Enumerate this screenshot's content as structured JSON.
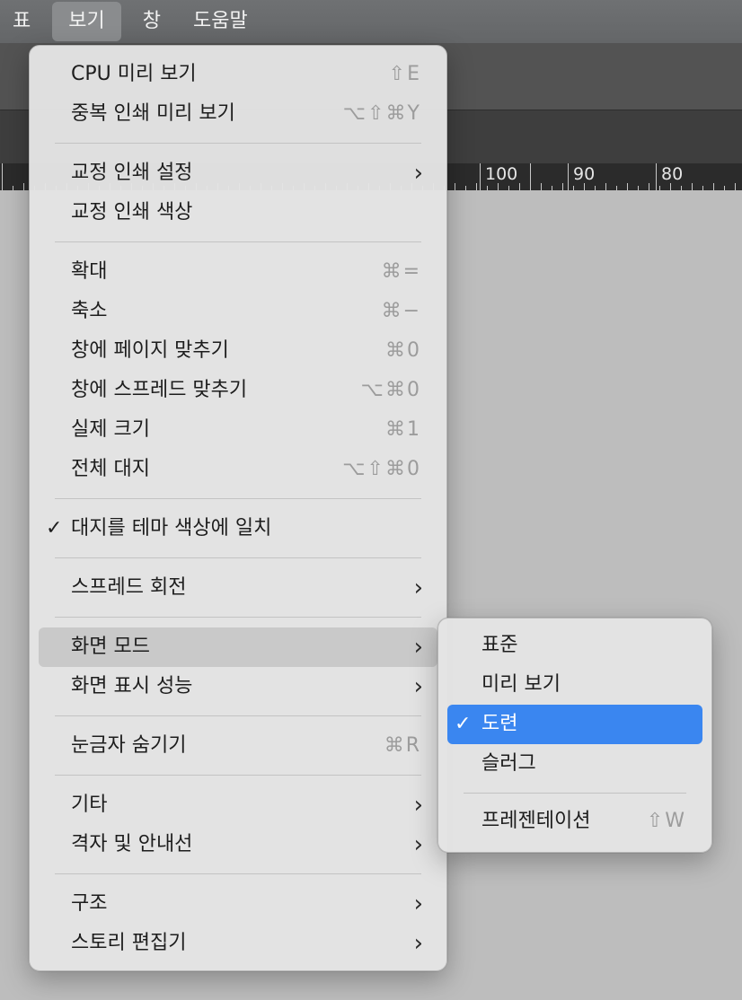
{
  "menubar": {
    "items": [
      {
        "label": "표"
      },
      {
        "label": "보기"
      },
      {
        "label": "창"
      },
      {
        "label": "도움말"
      }
    ]
  },
  "ruler": {
    "labels": [
      "100",
      "90",
      "80"
    ]
  },
  "view_menu": {
    "items": [
      {
        "label": "CPU 미리 보기",
        "shortcut": "⇧E"
      },
      {
        "label": "중복 인쇄 미리 보기",
        "shortcut": "⌥⇧⌘Y"
      },
      {
        "label": "교정 인쇄 설정",
        "submenu_arrow": "›"
      },
      {
        "label": "교정 인쇄 색상"
      },
      {
        "label": "확대",
        "shortcut": "⌘="
      },
      {
        "label": "축소",
        "shortcut": "⌘−"
      },
      {
        "label": "창에 페이지 맞추기",
        "shortcut": "⌘0"
      },
      {
        "label": "창에 스프레드 맞추기",
        "shortcut": "⌥⌘0"
      },
      {
        "label": "실제 크기",
        "shortcut": "⌘1"
      },
      {
        "label": "전체 대지",
        "shortcut": "⌥⇧⌘0"
      },
      {
        "label": "대지를 테마 색상에 일치",
        "checked": true,
        "check_mark": "✓"
      },
      {
        "label": "스프레드 회전",
        "submenu_arrow": "›"
      },
      {
        "label": "화면 모드",
        "submenu_arrow": "›",
        "highlighted": true
      },
      {
        "label": "화면 표시 성능",
        "submenu_arrow": "›"
      },
      {
        "label": "눈금자 숨기기",
        "shortcut": "⌘R"
      },
      {
        "label": "기타",
        "submenu_arrow": "›"
      },
      {
        "label": "격자 및 안내선",
        "submenu_arrow": "›"
      },
      {
        "label": "구조",
        "submenu_arrow": "›"
      },
      {
        "label": "스토리 편집기",
        "submenu_arrow": "›"
      }
    ]
  },
  "screen_mode_submenu": {
    "items": [
      {
        "label": "표준"
      },
      {
        "label": "미리 보기"
      },
      {
        "label": "도련",
        "checked": true,
        "check_mark": "✓"
      },
      {
        "label": "슬러그"
      },
      {
        "label": "프레젠테이션",
        "shortcut": "⇧W"
      }
    ]
  },
  "colors": {
    "selection_blue": "#3a86f0",
    "menu_background": "#e4e4e4",
    "shortcut_gray": "#9c9c9c"
  }
}
